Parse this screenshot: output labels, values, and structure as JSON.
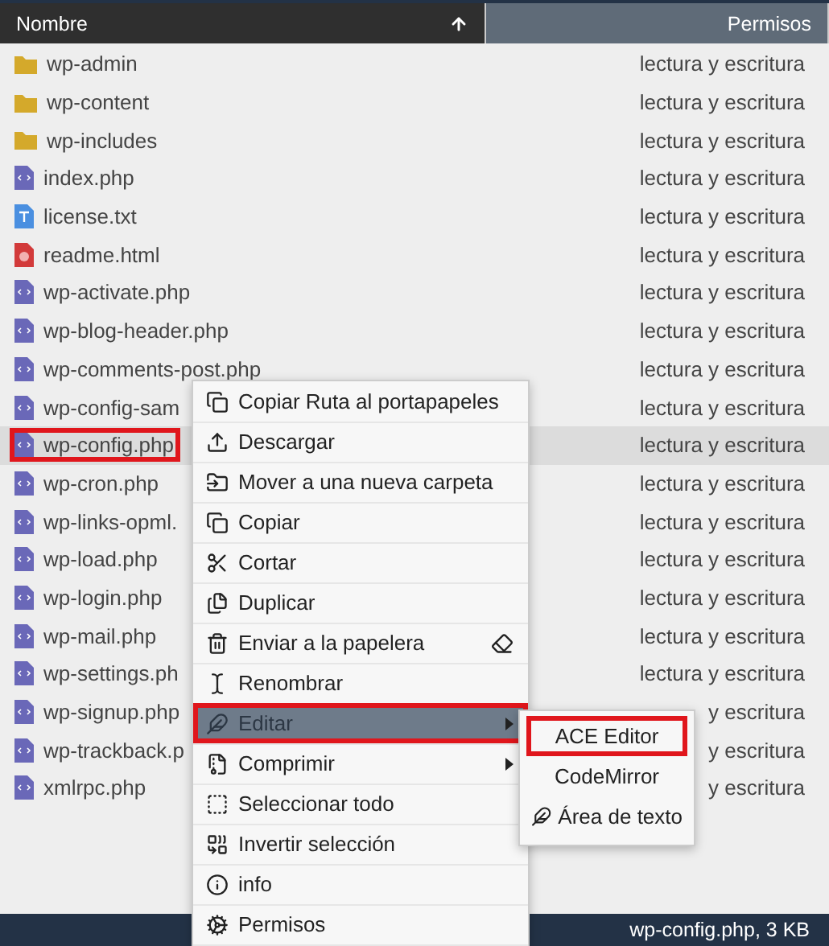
{
  "table": {
    "columns": [
      {
        "label": "Nombre",
        "sorted": true
      },
      {
        "label": "Permisos",
        "sorted": false
      }
    ],
    "rows": [
      {
        "name": "wp-admin",
        "kind": "folder",
        "permissions": "lectura y escritura",
        "selected": false,
        "annotated": false
      },
      {
        "name": "wp-content",
        "kind": "folder",
        "permissions": "lectura y escritura",
        "selected": false,
        "annotated": false
      },
      {
        "name": "wp-includes",
        "kind": "folder",
        "permissions": "lectura y escritura",
        "selected": false,
        "annotated": false
      },
      {
        "name": "index.php",
        "kind": "php",
        "permissions": "lectura y escritura",
        "selected": false,
        "annotated": false
      },
      {
        "name": "license.txt",
        "kind": "text",
        "permissions": "lectura y escritura",
        "selected": false,
        "annotated": false
      },
      {
        "name": "readme.html",
        "kind": "html",
        "permissions": "lectura y escritura",
        "selected": false,
        "annotated": false
      },
      {
        "name": "wp-activate.php",
        "kind": "php",
        "permissions": "lectura y escritura",
        "selected": false,
        "annotated": false
      },
      {
        "name": "wp-blog-header.php",
        "kind": "php",
        "permissions": "lectura y escritura",
        "selected": false,
        "annotated": false
      },
      {
        "name": "wp-comments-post.php",
        "kind": "php",
        "permissions": "lectura y escritura",
        "selected": false,
        "annotated": false
      },
      {
        "name": "wp-config-sam",
        "kind": "php",
        "permissions": "lectura y escritura",
        "selected": false,
        "annotated": false
      },
      {
        "name": "wp-config.php",
        "kind": "php",
        "permissions": "lectura y escritura",
        "selected": true,
        "annotated": true
      },
      {
        "name": "wp-cron.php",
        "kind": "php",
        "permissions": "lectura y escritura",
        "selected": false,
        "annotated": false
      },
      {
        "name": "wp-links-opml.",
        "kind": "php",
        "permissions": "lectura y escritura",
        "selected": false,
        "annotated": false
      },
      {
        "name": "wp-load.php",
        "kind": "php",
        "permissions": "lectura y escritura",
        "selected": false,
        "annotated": false
      },
      {
        "name": "wp-login.php",
        "kind": "php",
        "permissions": "lectura y escritura",
        "selected": false,
        "annotated": false
      },
      {
        "name": "wp-mail.php",
        "kind": "php",
        "permissions": "lectura y escritura",
        "selected": false,
        "annotated": false
      },
      {
        "name": "wp-settings.ph",
        "kind": "php",
        "permissions": "lectura y escritura",
        "selected": false,
        "annotated": false
      },
      {
        "name": "wp-signup.php",
        "kind": "php",
        "permissions": "y escritura",
        "selected": false,
        "annotated": false
      },
      {
        "name": "wp-trackback.p",
        "kind": "php",
        "permissions": "y escritura",
        "selected": false,
        "annotated": false
      },
      {
        "name": "xmlrpc.php",
        "kind": "php",
        "permissions": "y escritura",
        "selected": false,
        "annotated": false
      }
    ]
  },
  "context_menu": {
    "items": [
      {
        "label": "Copiar Ruta al portapapeles",
        "selected": false,
        "submenu": false,
        "annotated": false
      },
      {
        "label": "Descargar",
        "selected": false,
        "submenu": false,
        "annotated": false
      },
      {
        "label": "Mover a una nueva carpeta",
        "selected": false,
        "submenu": false,
        "annotated": false
      },
      {
        "label": "Copiar",
        "selected": false,
        "submenu": false,
        "annotated": false
      },
      {
        "label": "Cortar",
        "selected": false,
        "submenu": false,
        "annotated": false
      },
      {
        "label": "Duplicar",
        "selected": false,
        "submenu": false,
        "annotated": false
      },
      {
        "label": "Enviar a la papelera",
        "selected": false,
        "submenu": false,
        "annotated": false
      },
      {
        "label": "Renombrar",
        "selected": false,
        "submenu": false,
        "annotated": false
      },
      {
        "label": "Editar",
        "selected": true,
        "submenu": true,
        "annotated": true
      },
      {
        "label": "Comprimir",
        "selected": false,
        "submenu": true,
        "annotated": false
      },
      {
        "label": "Seleccionar todo",
        "selected": false,
        "submenu": false,
        "annotated": false
      },
      {
        "label": "Invertir selección",
        "selected": false,
        "submenu": false,
        "annotated": false
      },
      {
        "label": "info",
        "selected": false,
        "submenu": false,
        "annotated": false
      },
      {
        "label": "Permisos",
        "selected": false,
        "submenu": false,
        "annotated": false
      }
    ]
  },
  "submenu": {
    "items": [
      {
        "label": "ACE Editor",
        "icon": false,
        "annotated": true
      },
      {
        "label": "CodeMirror",
        "icon": false,
        "annotated": false
      },
      {
        "label": "Área de texto",
        "icon": true,
        "annotated": false
      }
    ]
  },
  "status_bar": {
    "text": "wp-config.php, 3 KB"
  }
}
